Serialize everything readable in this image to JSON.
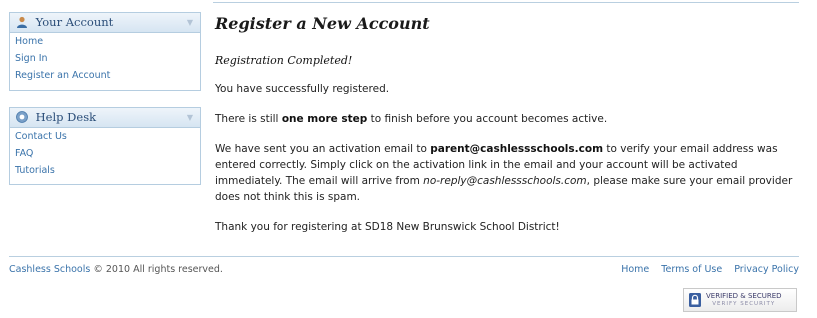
{
  "sidebar": {
    "account": {
      "title": "Your Account",
      "items": [
        {
          "label": "Home"
        },
        {
          "label": "Sign In"
        },
        {
          "label": "Register an Account"
        }
      ]
    },
    "help": {
      "title": "Help Desk",
      "items": [
        {
          "label": "Contact Us"
        },
        {
          "label": "FAQ"
        },
        {
          "label": "Tutorials"
        }
      ]
    }
  },
  "main": {
    "title": "Register a New Account",
    "subtitle": "Registration Completed!",
    "p1": "You have successfully registered.",
    "p2": {
      "before": "There is still ",
      "bold": "one more step",
      "after": " to finish before you account becomes active."
    },
    "p3": {
      "before": "We have sent you an activation email to ",
      "email": "parent@cashlessschools.com",
      "middle": " to verify your email address was entered correctly. Simply click on the activation link in the email and your account will be activated immediately. The email will arrive from ",
      "from": "no-reply@cashlessschools.com",
      "after": ", please make sure your email provider does not think this is spam."
    },
    "p4": "Thank you for registering at SD18 New Brunswick School District!"
  },
  "footer": {
    "brand": "Cashless Schools",
    "copyright": "© 2010 All rights reserved.",
    "links": [
      {
        "label": "Home"
      },
      {
        "label": "Terms of Use"
      },
      {
        "label": "Privacy Policy"
      }
    ],
    "badge": {
      "line1": "VERIFIED & SECURED",
      "line2": "VERIFY SECURITY"
    }
  },
  "colors": {
    "link": "#3a73aa",
    "panel_border": "#b5cde0",
    "panel_title": "#2a4d78"
  },
  "icons": {
    "account": "user-icon",
    "help": "help-icon",
    "collapse": "chevron-down-icon",
    "badge": "lock-icon"
  }
}
